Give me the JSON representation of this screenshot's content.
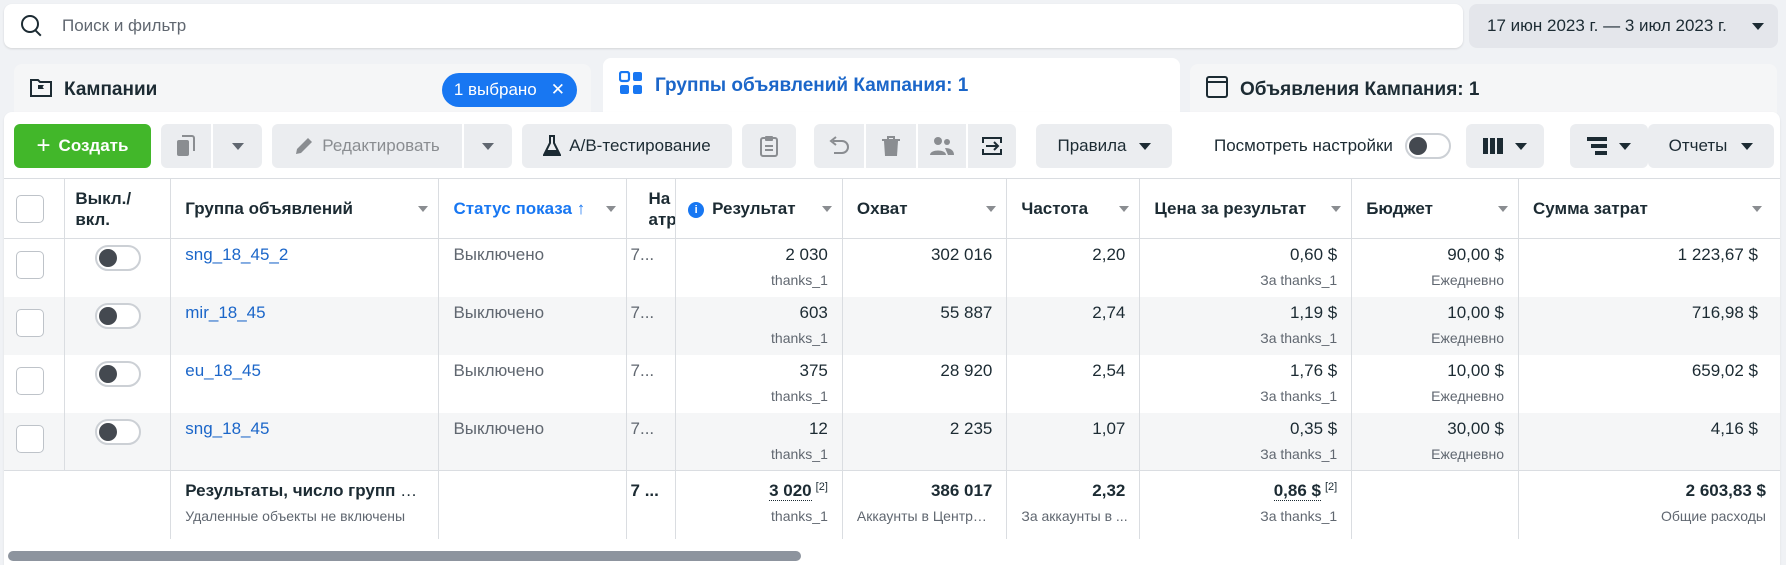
{
  "search": {
    "placeholder": "Поиск и фильтр"
  },
  "date_range": "17 июн 2023 г. — 3 июл 2023 г.",
  "tabs": {
    "campaigns": {
      "label": "Кампании",
      "badge": "1 выбрано"
    },
    "adsets": {
      "label": "Группы объявлений Кампания: 1"
    },
    "ads": {
      "label": "Объявления Кампания: 1"
    }
  },
  "toolbar": {
    "create": "Создать",
    "edit": "Редактировать",
    "ab_test": "A/B-тестирование",
    "rules": "Правила",
    "view_settings": "Посмотреть настройки",
    "reports": "Отчеты"
  },
  "columns": {
    "toggle": "Выкл./ вкл.",
    "name": "Группа объявлений",
    "status": "Статус показа ↑",
    "attribution": "На атр",
    "result": "Результат",
    "reach": "Охват",
    "frequency": "Частота",
    "cost_per_result": "Цена за результат",
    "budget": "Бюджет",
    "spend": "Сумма затрат"
  },
  "rows": [
    {
      "name": "sng_18_45_2",
      "status": "Выключено",
      "attribution": "7...",
      "result": "2 030",
      "result_sub": "thanks_1",
      "reach": "302 016",
      "frequency": "2,20",
      "cost": "0,60 $",
      "cost_sub": "За thanks_1",
      "budget": "90,00 $",
      "budget_sub": "Ежедневно",
      "spend": "1 223,67 $"
    },
    {
      "name": "mir_18_45",
      "status": "Выключено",
      "attribution": "7...",
      "result": "603",
      "result_sub": "thanks_1",
      "reach": "55 887",
      "frequency": "2,74",
      "cost": "1,19 $",
      "cost_sub": "За thanks_1",
      "budget": "10,00 $",
      "budget_sub": "Ежедневно",
      "spend": "716,98 $"
    },
    {
      "name": "eu_18_45",
      "status": "Выключено",
      "attribution": "7...",
      "result": "375",
      "result_sub": "thanks_1",
      "reach": "28 920",
      "frequency": "2,54",
      "cost": "1,76 $",
      "cost_sub": "За thanks_1",
      "budget": "10,00 $",
      "budget_sub": "Ежедневно",
      "spend": "659,02 $"
    },
    {
      "name": "sng_18_45",
      "status": "Выключено",
      "attribution": "7...",
      "result": "12",
      "result_sub": "thanks_1",
      "reach": "2 235",
      "frequency": "1,07",
      "cost": "0,35 $",
      "cost_sub": "За thanks_1",
      "budget": "30,00 $",
      "budget_sub": "Ежедневно",
      "spend": "4,16 $"
    }
  ],
  "totals": {
    "label": "Результаты, число групп о...",
    "label_sub": "Удаленные объекты не включены",
    "attribution": "7 ...",
    "result": "3 020",
    "result_note": "[2]",
    "result_sub": "thanks_1",
    "reach": "386 017",
    "reach_sub": "Аккаунты в Центре ...",
    "frequency": "2,32",
    "frequency_sub": "За аккаунты в ...",
    "cost": "0,86 $",
    "cost_note": "[2]",
    "cost_sub": "За thanks_1",
    "spend": "2 603,83 $",
    "spend_sub": "Общие расходы"
  },
  "colors": {
    "accent": "#1877f2",
    "create": "#42b72a",
    "link": "#1b66c9"
  }
}
